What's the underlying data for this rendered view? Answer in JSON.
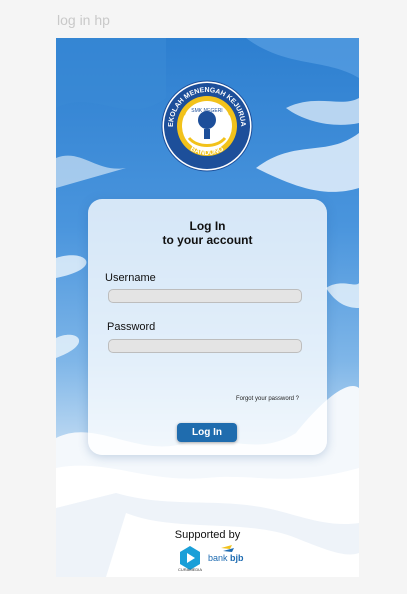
{
  "frame": {
    "label": "log in hp"
  },
  "emblem": {
    "top_text": "SEKOLAH MENENGAH KEJURUAN",
    "bottom_text": "BANDUNG",
    "center_text": "SMK NEGERI"
  },
  "login": {
    "title": "Log In",
    "subtitle": "to your account",
    "username_label": "Username",
    "username_value": "",
    "password_label": "Password",
    "password_value": "",
    "forgot_label": "Forgot your password ?",
    "submit_label": "Log In"
  },
  "footer": {
    "supported_label": "Supported by",
    "sponsor1": "CURAMEDIA",
    "sponsor2_prefix": "bank ",
    "sponsor2_name": "bjb"
  },
  "colors": {
    "sky_top": "#2d7fd0",
    "button": "#1f6cae",
    "accent_yellow": "#f2c21b"
  }
}
